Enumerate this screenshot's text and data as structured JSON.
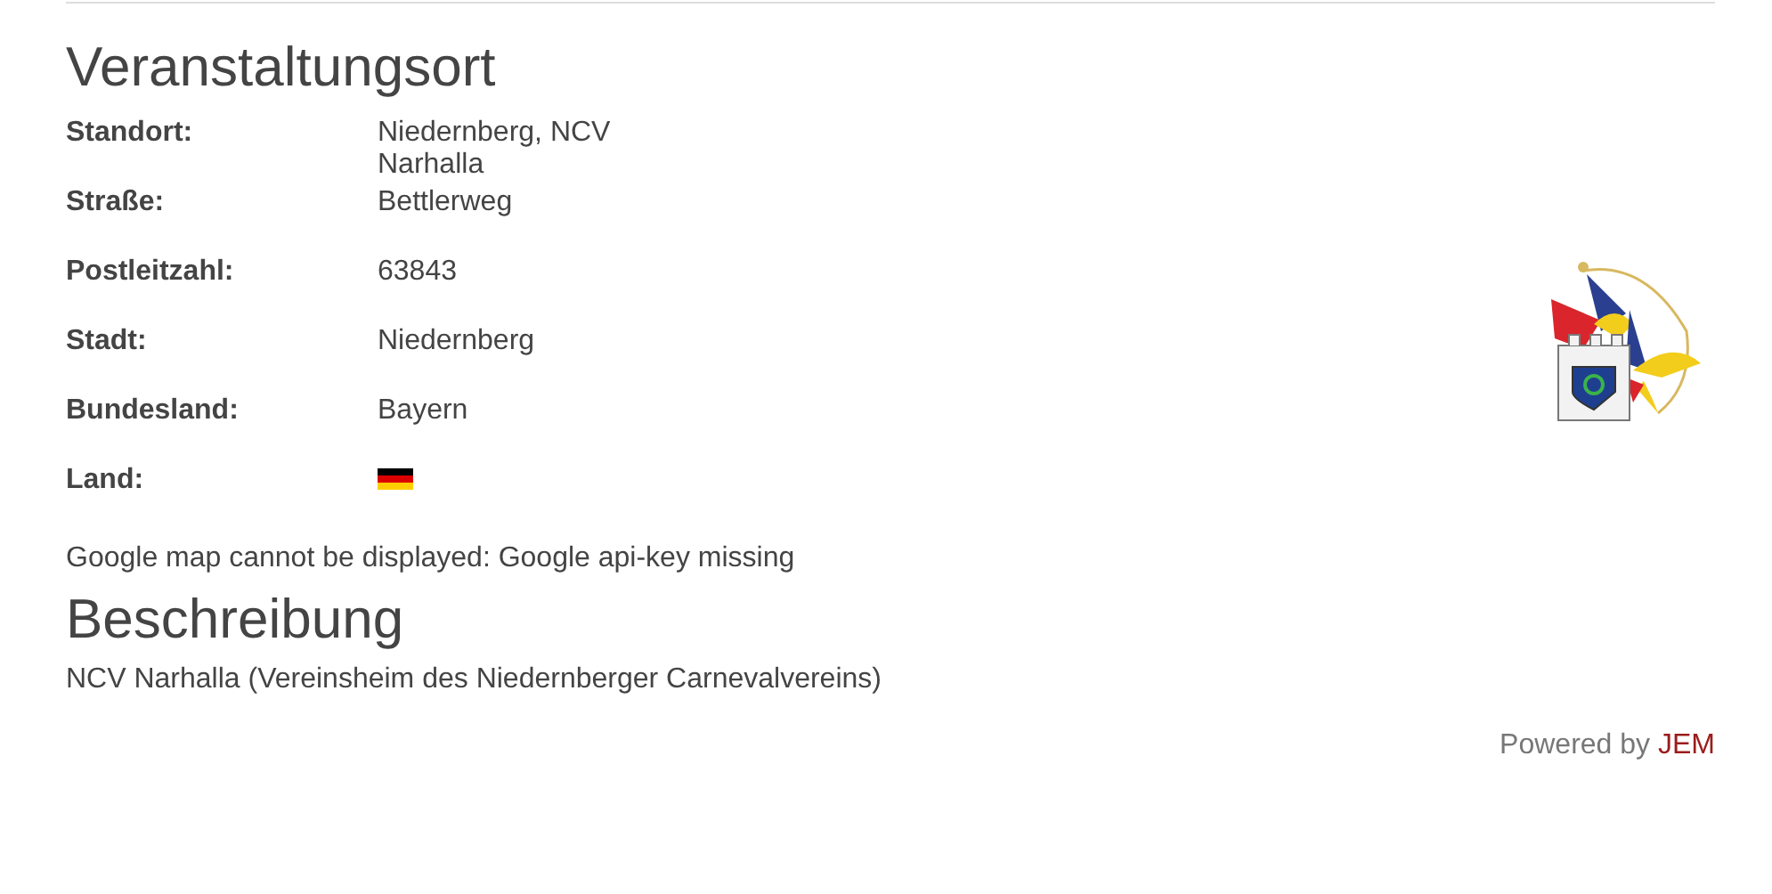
{
  "venue": {
    "heading": "Veranstaltungsort",
    "fields": [
      {
        "label": "Standort:",
        "kind": "text",
        "value": "Niedernberg, NCV Narhalla"
      },
      {
        "label": "Straße:",
        "kind": "text",
        "value": "Bettlerweg"
      },
      {
        "label": "Postleitzahl:",
        "kind": "text",
        "value": "63843"
      },
      {
        "label": "Stadt:",
        "kind": "text",
        "value": "Niedernberg"
      },
      {
        "label": "Bundesland:",
        "kind": "text",
        "value": "Bayern"
      },
      {
        "label": "Land:",
        "kind": "flag"
      }
    ],
    "map_notice": "Google map cannot be displayed: Google api-key missing"
  },
  "description": {
    "heading": "Beschreibung",
    "text": "NCV Narhalla (Vereinsheim des Niedernberger Carnevalvereins)"
  },
  "footer": {
    "prefix": "Powered by",
    "link": "JEM"
  }
}
